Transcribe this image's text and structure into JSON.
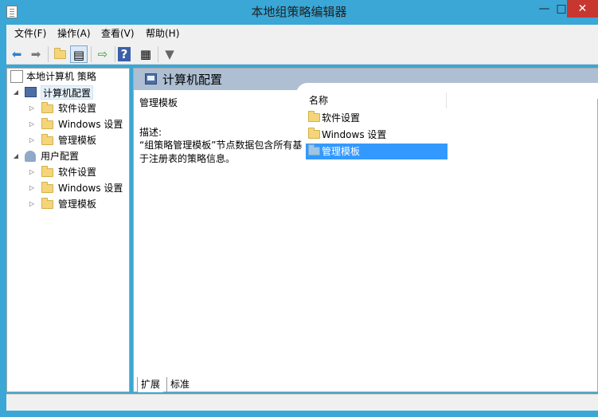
{
  "window": {
    "title": "本地组策略编辑器"
  },
  "menubar": [
    "文件(F)",
    "操作(A)",
    "查看(V)",
    "帮助(H)"
  ],
  "tree": {
    "root": "本地计算机 策略",
    "computer": {
      "label": "计算机配置",
      "children": [
        "软件设置",
        "Windows 设置",
        "管理模板"
      ]
    },
    "user": {
      "label": "用户配置",
      "children": [
        "软件设置",
        "Windows 设置",
        "管理模板"
      ]
    }
  },
  "right": {
    "header": "计算机配置",
    "desc_title": "管理模板",
    "desc_label": "描述:",
    "desc_text": "“组策略管理模板”节点数据包含所有基于注册表的策略信息。",
    "column_name": "名称",
    "items": [
      "软件设置",
      "Windows 设置",
      "管理模板"
    ],
    "selected_index": 2
  },
  "tabs": [
    "扩展",
    "标准"
  ],
  "colors": {
    "accent": "#3aa7d6",
    "header": "#aebfd3",
    "selection": "#3399ff"
  },
  "icons": {
    "back": "back-arrow-icon",
    "forward": "forward-arrow-icon",
    "filter": "filter-icon"
  }
}
